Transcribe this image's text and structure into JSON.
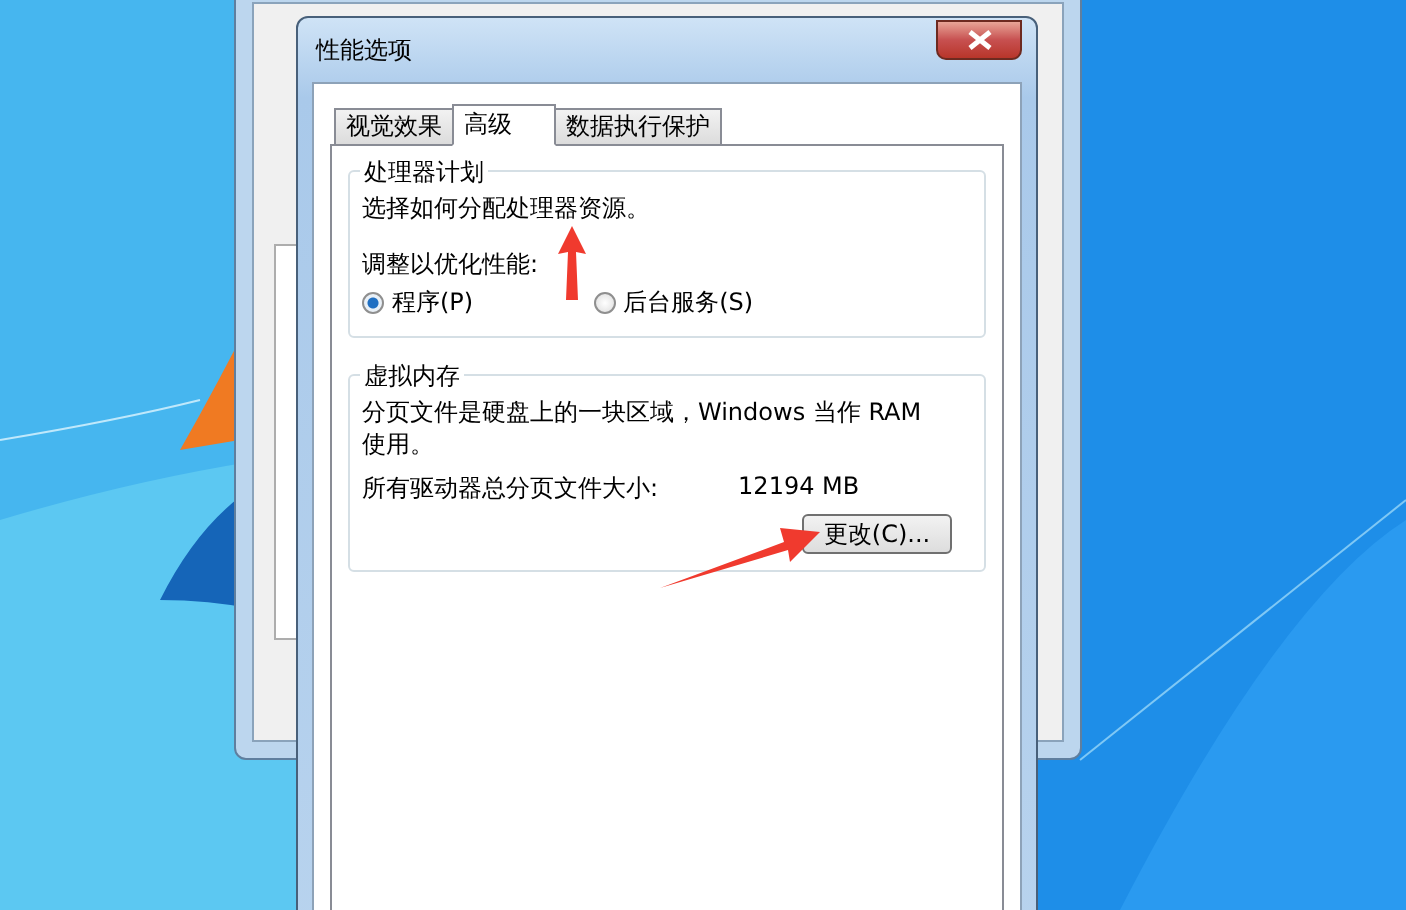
{
  "dialog": {
    "title": "性能选项",
    "tabs": [
      {
        "label": "视觉效果",
        "selected": false
      },
      {
        "label": "高级",
        "selected": true
      },
      {
        "label": "数据执行保护",
        "selected": false
      }
    ],
    "processor_group": {
      "title": "处理器计划",
      "description": "选择如何分配处理器资源。",
      "prompt": "调整以优化性能:",
      "options": [
        {
          "label": "程序(P)",
          "selected": true
        },
        {
          "label": "后台服务(S)",
          "selected": false
        }
      ]
    },
    "virtual_memory_group": {
      "title": "虚拟内存",
      "description": "分页文件是硬盘上的一块区域，Windows 当作 RAM 使用。",
      "total_label": "所有驱动器总分页文件大小:",
      "total_value": "12194 MB",
      "change_button": "更改(C)..."
    }
  }
}
